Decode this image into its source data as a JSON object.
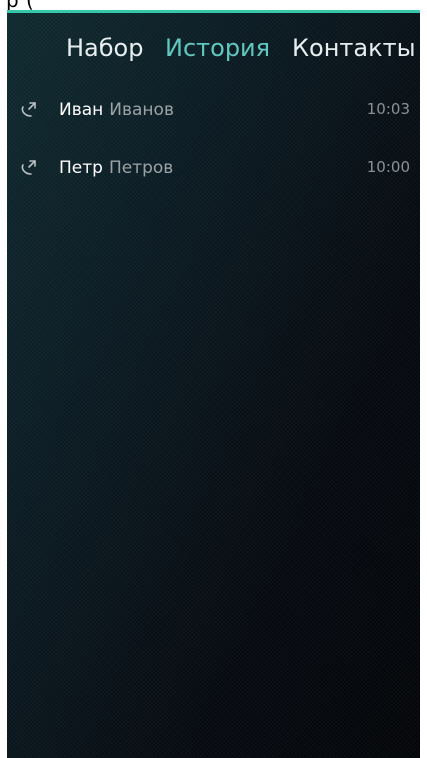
{
  "top_cut_text": "р                                                          (",
  "tabs": [
    {
      "label": "Набор"
    },
    {
      "label": "История"
    },
    {
      "label": "Контакты"
    }
  ],
  "active_tab": "История",
  "calls": [
    {
      "first_name": "Иван",
      "last_name": "Иванов",
      "time": "10:03",
      "icon": "outgoing-call-icon"
    },
    {
      "first_name": "Петр",
      "last_name": "Петров",
      "time": "10:00",
      "icon": "outgoing-call-icon"
    }
  ],
  "colors": {
    "accent": "#35c7a8",
    "active_tab": "#60c8be",
    "text": "#ffffff",
    "secondary_text": "#9ca3a6"
  }
}
